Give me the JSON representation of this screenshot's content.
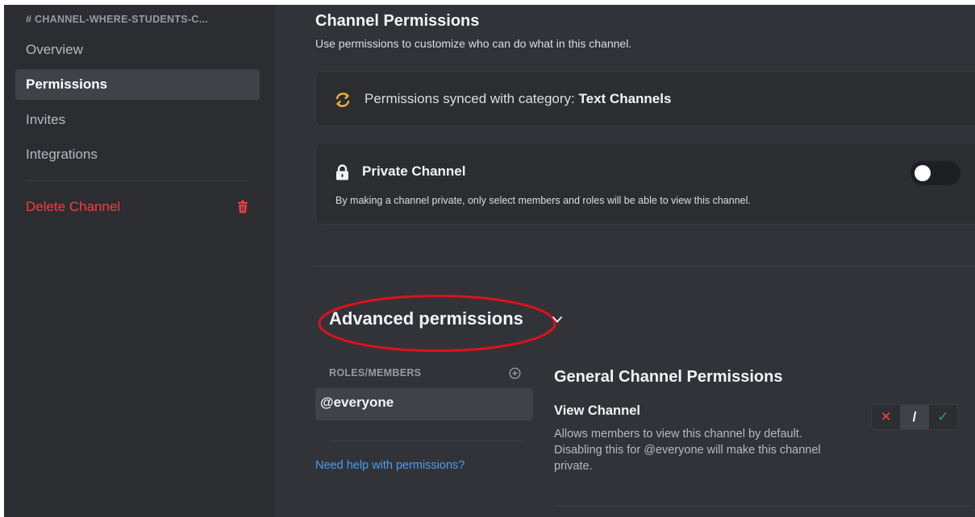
{
  "sidebar": {
    "channel_header": "# CHANNEL-WHERE-STUDENTS-C...",
    "items": [
      {
        "label": "Overview"
      },
      {
        "label": "Permissions"
      },
      {
        "label": "Invites"
      },
      {
        "label": "Integrations"
      }
    ],
    "active_item": "Permissions",
    "delete_label": "Delete Channel"
  },
  "main": {
    "title": "Channel Permissions",
    "description": "Use permissions to customize who can do what in this channel.",
    "sync": {
      "prefix": "Permissions synced with category: ",
      "category": "Text Channels",
      "icon": "sync-icon"
    },
    "private_channel": {
      "title": "Private Channel",
      "description": "By making a channel private, only select members and roles will be able to view this channel.",
      "toggle_on": false,
      "icon": "lock-icon"
    },
    "advanced": {
      "title": "Advanced permissions",
      "roles_header": "ROLES/MEMBERS",
      "roles": [
        {
          "name": "@everyone"
        }
      ],
      "help_link": "Need help with permissions?",
      "section_title": "General Channel Permissions",
      "permissions": [
        {
          "name": "View Channel",
          "description": "Allows members to view this channel by default. Disabling this for @everyone will make this channel private.",
          "state": "neutral",
          "deny_glyph": "✕",
          "neutral_glyph": "/",
          "allow_glyph": "✓"
        }
      ]
    }
  },
  "colors": {
    "background": "#313338",
    "sidebar": "#2b2d31",
    "danger": "#f23f43",
    "success": "#23a55a",
    "link": "#4a9ef0",
    "sync_icon": "#f0b232",
    "annotation": "#e0101a"
  }
}
